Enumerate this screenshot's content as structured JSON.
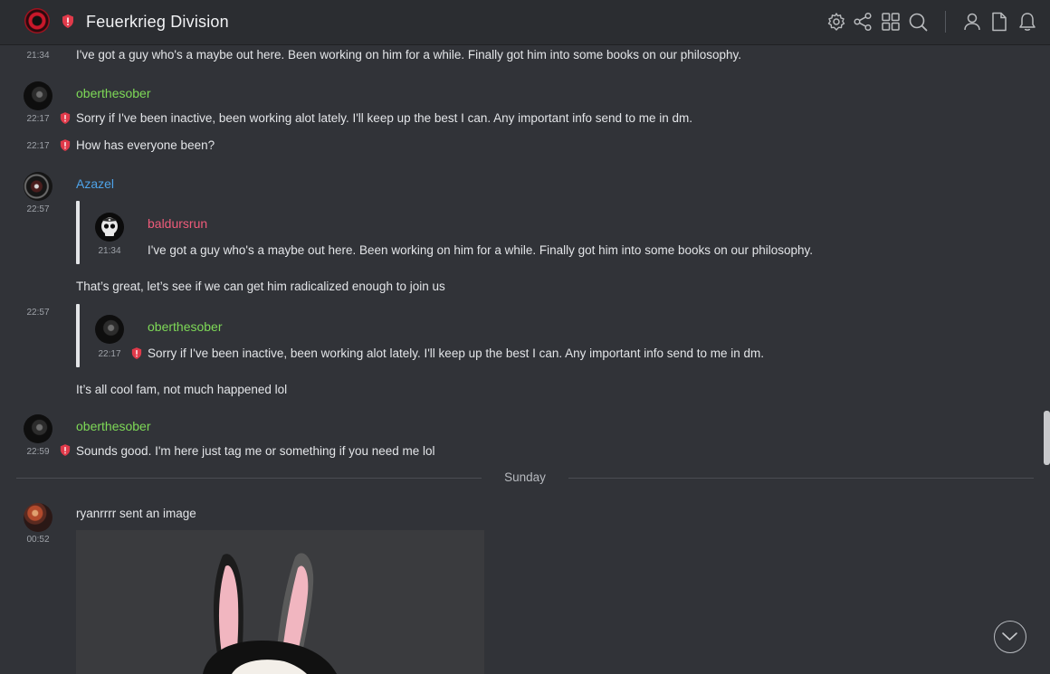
{
  "header": {
    "server_name": "Feuerkrieg Division",
    "icons": [
      "settings-icon",
      "share-icon",
      "grid-icon",
      "search-icon",
      "user-icon",
      "file-icon",
      "bell-icon"
    ]
  },
  "colors": {
    "background": "#313338",
    "username_green": "#7ed957",
    "username_blue": "#4ea3e8",
    "username_pink": "#ef5b7a",
    "badge_red": "#e03a4a"
  },
  "messages": {
    "m0": {
      "time": "21:34",
      "text": "I've got a guy who's a maybe out here. Been working on him for a while. Finally got him into some books on our philosophy."
    },
    "m1": {
      "author": "oberthesober",
      "time": "22:17",
      "text": "Sorry if I've been inactive, been working alot lately. I'll keep up the best I can. Any important info send to me in dm."
    },
    "m2": {
      "time": "22:17",
      "text": "How has everyone been?"
    },
    "m3": {
      "author": "Azazel",
      "time": "22:57",
      "quote": {
        "author": "baldursrun",
        "time": "21:34",
        "text": "I've got a guy who's a maybe out here. Been working on him for a while. Finally got him into some books on our philosophy."
      },
      "text": "That’s great, let’s see if we can get him radicalized enough to join us"
    },
    "m4": {
      "time": "22:57",
      "quote": {
        "author": "oberthesober",
        "time": "22:17",
        "text": "Sorry if I've been inactive, been working alot lately. I'll keep up the best I can. Any important info send to me in dm."
      },
      "text": "It’s all cool fam, not much happened lol"
    },
    "m5": {
      "author": "oberthesober",
      "time": "22:59",
      "text": "Sounds good. I'm here just tag me or something if you need me lol"
    },
    "divider": "Sunday",
    "m6": {
      "time": "00:52",
      "text": "ryanrrrr sent an image"
    }
  }
}
